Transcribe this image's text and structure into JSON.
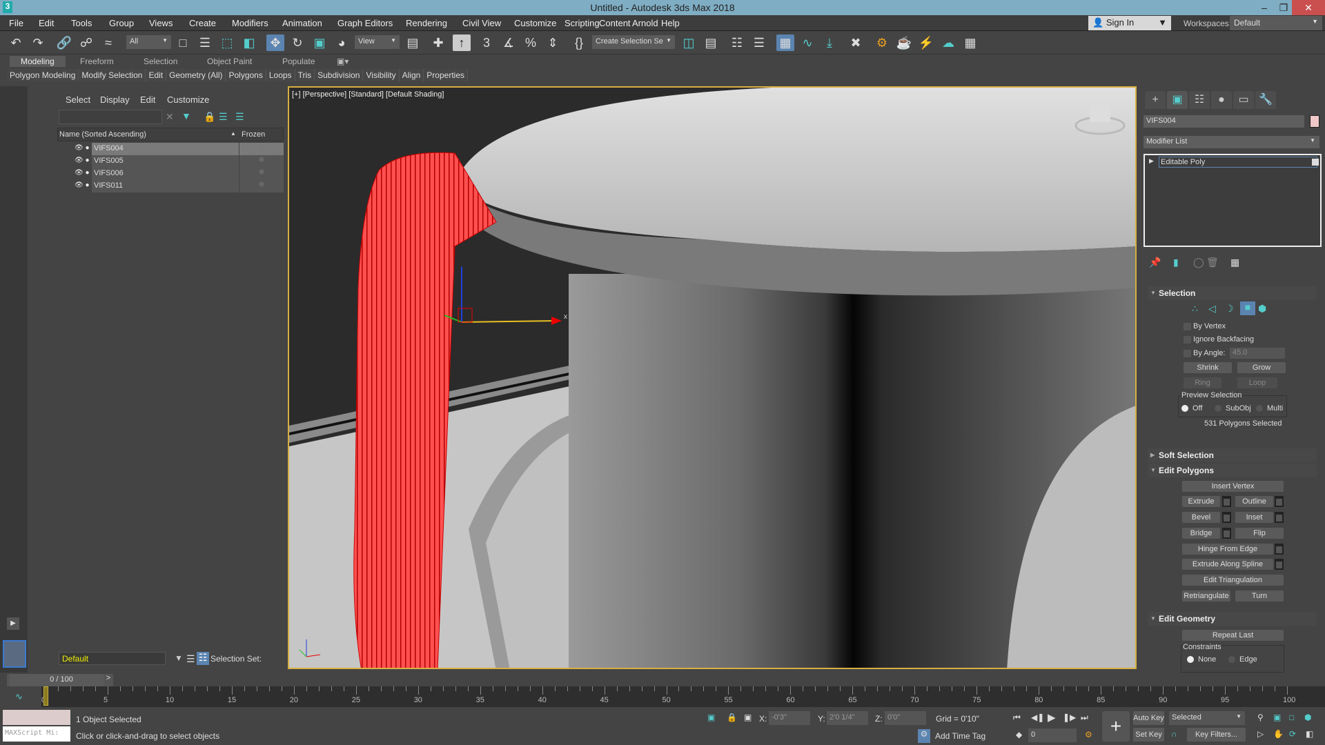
{
  "window": {
    "title": "Untitled - Autodesk 3ds Max 2018",
    "app_icon": "3"
  },
  "menu": [
    "File",
    "Edit",
    "Tools",
    "Group",
    "Views",
    "Create",
    "Modifiers",
    "Animation",
    "Graph Editors",
    "Rendering",
    "Civil View",
    "Customize",
    "Scripting",
    "Content",
    "Arnold",
    "Help"
  ],
  "account": {
    "sign_in": "Sign In",
    "workspaces_label": "Workspaces:",
    "workspace": "Default"
  },
  "toolbar": {
    "selection_filter": "All",
    "ref_coord": "View",
    "named_selection": "Create Selection Se"
  },
  "ribbon": {
    "tabs": [
      "Modeling",
      "Freeform",
      "Selection",
      "Object Paint",
      "Populate"
    ],
    "active_tab": "Modeling",
    "panels": [
      "Polygon Modeling",
      "Modify Selection",
      "Edit",
      "Geometry (All)",
      "Polygons",
      "Loops",
      "Tris",
      "Subdivision",
      "Visibility",
      "Align",
      "Properties"
    ]
  },
  "explorer": {
    "menus": [
      "Select",
      "Display",
      "Edit",
      "Customize"
    ],
    "search_value": "",
    "columns": {
      "name": "Name (Sorted Ascending)",
      "frozen": "Frozen"
    },
    "rows": [
      {
        "name": "VIFS004",
        "selected": true
      },
      {
        "name": "VIFS005",
        "selected": false
      },
      {
        "name": "VIFS006",
        "selected": false
      },
      {
        "name": "VIFS011",
        "selected": false
      }
    ],
    "layer": "Default",
    "selection_set_label": "Selection Set:"
  },
  "viewport": {
    "label": "[+] [Perspective] [Standard] [Default Shading]",
    "selection_color": "#ff3b3b",
    "axis_x": "x",
    "axis_y": "y"
  },
  "command_panel": {
    "object_name": "VIFS004",
    "object_color": "#f0c8c8",
    "modifier_list": "Modifier List",
    "stack": [
      "Editable Poly"
    ],
    "selection": {
      "title": "Selection",
      "by_vertex": "By Vertex",
      "ignore_backfacing": "Ignore Backfacing",
      "by_angle": "By Angle:",
      "angle_value": "45.0",
      "shrink": "Shrink",
      "grow": "Grow",
      "ring": "Ring",
      "loop": "Loop",
      "preview_label": "Preview Selection",
      "preview_options": [
        "Off",
        "SubObj",
        "Multi"
      ],
      "preview_selected": "Off",
      "status": "531 Polygons Selected"
    },
    "soft_selection": {
      "title": "Soft Selection"
    },
    "edit_polygons": {
      "title": "Edit Polygons",
      "insert_vertex": "Insert Vertex",
      "extrude": "Extrude",
      "outline": "Outline",
      "bevel": "Bevel",
      "inset": "Inset",
      "bridge": "Bridge",
      "flip": "Flip",
      "hinge": "Hinge From Edge",
      "extrude_spline": "Extrude Along Spline",
      "edit_tri": "Edit Triangulation",
      "retriangulate": "Retriangulate",
      "turn": "Turn"
    },
    "edit_geometry": {
      "title": "Edit Geometry",
      "repeat_last": "Repeat Last",
      "constraints": "Constraints",
      "none": "None",
      "edge": "Edge"
    }
  },
  "timeline": {
    "current": "0 / 100",
    "ticks": [
      0,
      5,
      10,
      15,
      20,
      25,
      30,
      35,
      40,
      45,
      50,
      55,
      60,
      65,
      70,
      75,
      80,
      85,
      90,
      95,
      100
    ]
  },
  "status": {
    "maxscript": "MAXScript Mi:",
    "selected": "1 Object Selected",
    "prompt": "Click or click-and-drag to select objects",
    "x_label": "X:",
    "x": "-0'3\"",
    "y_label": "Y:",
    "y": "2'0 1/4\"",
    "z_label": "Z:",
    "z": "0'0\"",
    "grid": "Grid = 0'10\"",
    "add_time_tag": "Add Time Tag",
    "frame": "0",
    "auto_key": "Auto Key",
    "set_key": "Set Key",
    "key_mode": "Selected",
    "key_filters": "Key Filters..."
  }
}
